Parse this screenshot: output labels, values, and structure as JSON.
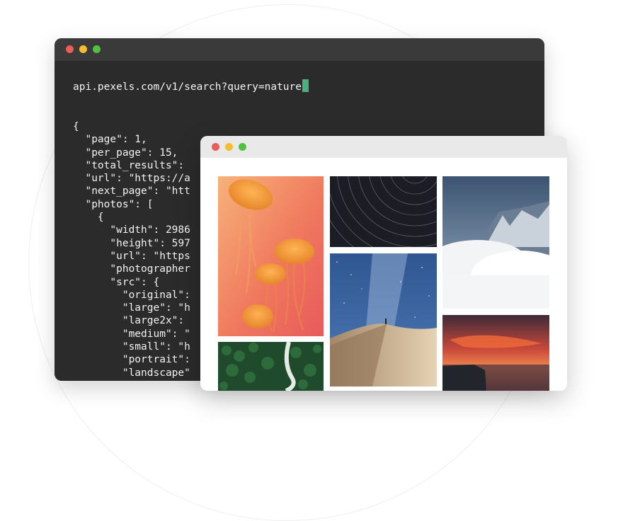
{
  "colors": {
    "dot_red": "#ec5d56",
    "dot_yellow": "#f6bd30",
    "dot_green": "#50c23f",
    "cursor": "#4caf7f",
    "terminal_bg": "#2b2b2b",
    "terminal_titlebar": "#3a3a3a",
    "browser_titlebar": "#e9e9e9"
  },
  "terminal": {
    "url": "api.pexels.com/v1/search?query=nature",
    "json_lines": [
      "{",
      "  \"page\": 1,",
      "  \"per_page\": 15,",
      "  \"total_results\":",
      "  \"url\": \"https://a",
      "  \"next_page\": \"htt",
      "  \"photos\": [",
      "    {",
      "      \"width\": 2986",
      "      \"height\": 597",
      "      \"url\": \"https",
      "      \"photographer",
      "      \"src\": {",
      "        \"original\":",
      "        \"large\": \"h",
      "        \"large2x\":",
      "        \"medium\": \"",
      "        \"small\": \"h",
      "        \"portrait\":",
      "        \"landscape\""
    ]
  },
  "browser": {
    "photos": [
      {
        "subject": "jellyfish"
      },
      {
        "subject": "forest-road-aerial"
      },
      {
        "subject": "star-trails"
      },
      {
        "subject": "milky-way-desert"
      },
      {
        "subject": "snowy-mountain"
      },
      {
        "subject": "sunset-sea"
      }
    ]
  }
}
